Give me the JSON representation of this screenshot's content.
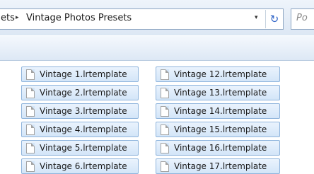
{
  "address_bar": {
    "previous_crumb": "ets",
    "separator": "▸",
    "current_crumb": "Vintage Photos Presets",
    "dropdown_glyph": "▾",
    "refresh_glyph": "↻"
  },
  "search": {
    "placeholder_partial": "Po"
  },
  "files": {
    "column1": [
      "Vintage 1.lrtemplate",
      "Vintage 2.lrtemplate",
      "Vintage 3.lrtemplate",
      "Vintage 4.lrtemplate",
      "Vintage 5.lrtemplate",
      "Vintage 6.lrtemplate"
    ],
    "column2": [
      "Vintage 12.lrtemplate",
      "Vintage 13.lrtemplate",
      "Vintage 14.lrtemplate",
      "Vintage 15.lrtemplate",
      "Vintage 16.lrtemplate",
      "Vintage 17.lrtemplate"
    ]
  },
  "colors": {
    "selection_border": "#8fb4dc",
    "selection_fill": "#d3e5f8",
    "accent": "#2f64c8"
  }
}
